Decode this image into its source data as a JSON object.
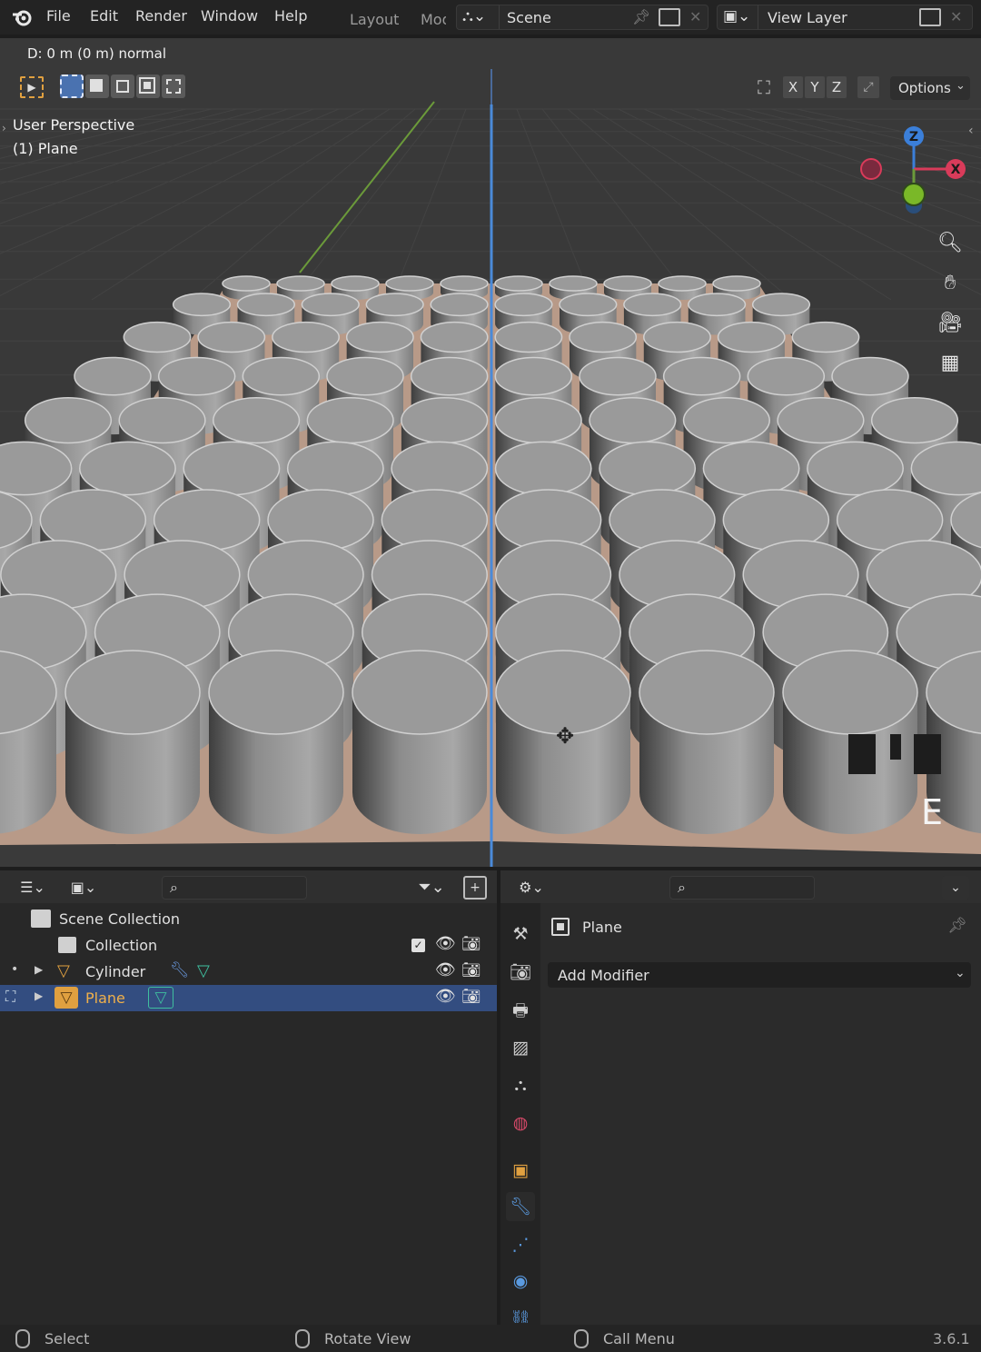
{
  "menu": {
    "items": [
      "File",
      "Edit",
      "Render",
      "Window",
      "Help"
    ],
    "workspace_tabs": [
      "Layout",
      "Mod"
    ],
    "scene_name": "Scene",
    "view_layer_name": "View Layer"
  },
  "viewport": {
    "operator_status": "D: 0 m (0 m) normal",
    "view_name": "User Perspective",
    "active_object": "(1) Plane",
    "axis_buttons": [
      "X",
      "Y",
      "Z"
    ],
    "options_label": "Options",
    "key_overlay": "E",
    "gizmo_labels": {
      "z": "Z",
      "x": "X"
    },
    "nav_icons": [
      "zoom-icon",
      "hand-pan-icon",
      "camera-icon",
      "grid-ortho-icon"
    ],
    "colors": {
      "background": "#393939",
      "cylinder": "#8a8a8a",
      "plane": "#b89a88",
      "y_axis": "#6b9a3a",
      "x_axis": "#d93b5a",
      "z_axis": "#3b7fd9",
      "cursor_line": "#4a8ad9"
    }
  },
  "outliner": {
    "search_placeholder": "",
    "rows": [
      {
        "label": "Scene Collection"
      },
      {
        "label": "Collection"
      },
      {
        "label": "Cylinder"
      },
      {
        "label": "Plane",
        "selected": true
      }
    ],
    "colors": {
      "selected_row": "#334d80",
      "object_icon": "#e0a040",
      "mesh_icon": "#3fbf9f"
    }
  },
  "properties": {
    "search_placeholder": "",
    "object_name": "Plane",
    "add_modifier_label": "Add Modifier",
    "tabs": [
      "tool",
      "render",
      "output",
      "view-layer",
      "scene",
      "world",
      "object",
      "modifier",
      "particles",
      "physics",
      "constraints"
    ],
    "active_tab": "modifier"
  },
  "statusbar": {
    "select": "Select",
    "rotate_view": "Rotate View",
    "call_menu": "Call Menu",
    "version": "3.6.1"
  }
}
